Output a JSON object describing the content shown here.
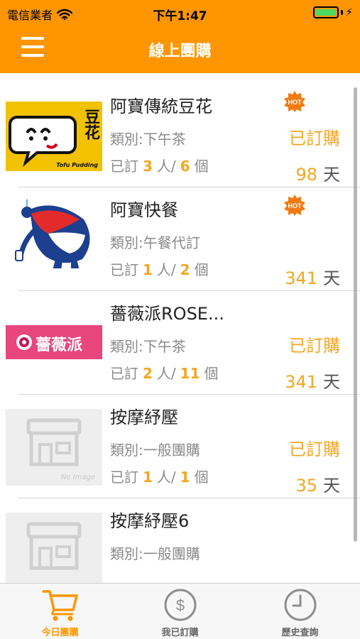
{
  "status_bar": {
    "carrier": "電信業者",
    "time": "下午1:47",
    "wifi_icon": "wifi-icon",
    "battery_icon": "battery-icon",
    "charging_symbol": "⚡"
  },
  "nav": {
    "title": "線上團購",
    "menu_icon": "hamburger-menu-icon"
  },
  "colors": {
    "accent": "#ff9500",
    "highlight": "#f5a623",
    "battery": "#4cd964"
  },
  "items": [
    {
      "title": "阿寶傳統豆花",
      "category": "類別:下午茶",
      "stats_prefix": "已訂",
      "people": "3",
      "people_unit": "人/",
      "count": "6",
      "count_unit": "個",
      "status": "已訂購",
      "days": "98",
      "days_unit": "天",
      "hot": true,
      "thumb_text": "豆花",
      "thumb_caption": "Tofu Pudding"
    },
    {
      "title": "阿寶快餐",
      "category": "類別:午餐代訂",
      "stats_prefix": "已訂",
      "people": "1",
      "people_unit": "人/",
      "count": "2",
      "count_unit": "個",
      "status": "",
      "days": "341",
      "days_unit": "天",
      "hot": true
    },
    {
      "title": "薔薇派ROSE...",
      "category": "類別:下午茶",
      "stats_prefix": "已訂",
      "people": "2",
      "people_unit": "人/",
      "count": "11",
      "count_unit": "個",
      "status": "已訂購",
      "days": "341",
      "days_unit": "天",
      "hot": false,
      "thumb_text": "薔薇派"
    },
    {
      "title": "按摩紓壓",
      "category": "類別:一般團購",
      "stats_prefix": "已訂",
      "people": "1",
      "people_unit": "人/",
      "count": "1",
      "count_unit": "個",
      "status": "已訂購",
      "days": "35",
      "days_unit": "天",
      "hot": false,
      "thumb_caption": "No Image"
    },
    {
      "title": "按摩紓壓6",
      "category": "類別:一般團購",
      "hot": false
    }
  ],
  "hot_badge": "HOT",
  "tabs": [
    {
      "label": "今日團購",
      "icon": "cart-icon",
      "active": true
    },
    {
      "label": "我已訂購",
      "icon": "dollar-coin-icon",
      "active": false
    },
    {
      "label": "歷史查詢",
      "icon": "clock-icon",
      "active": false
    }
  ]
}
